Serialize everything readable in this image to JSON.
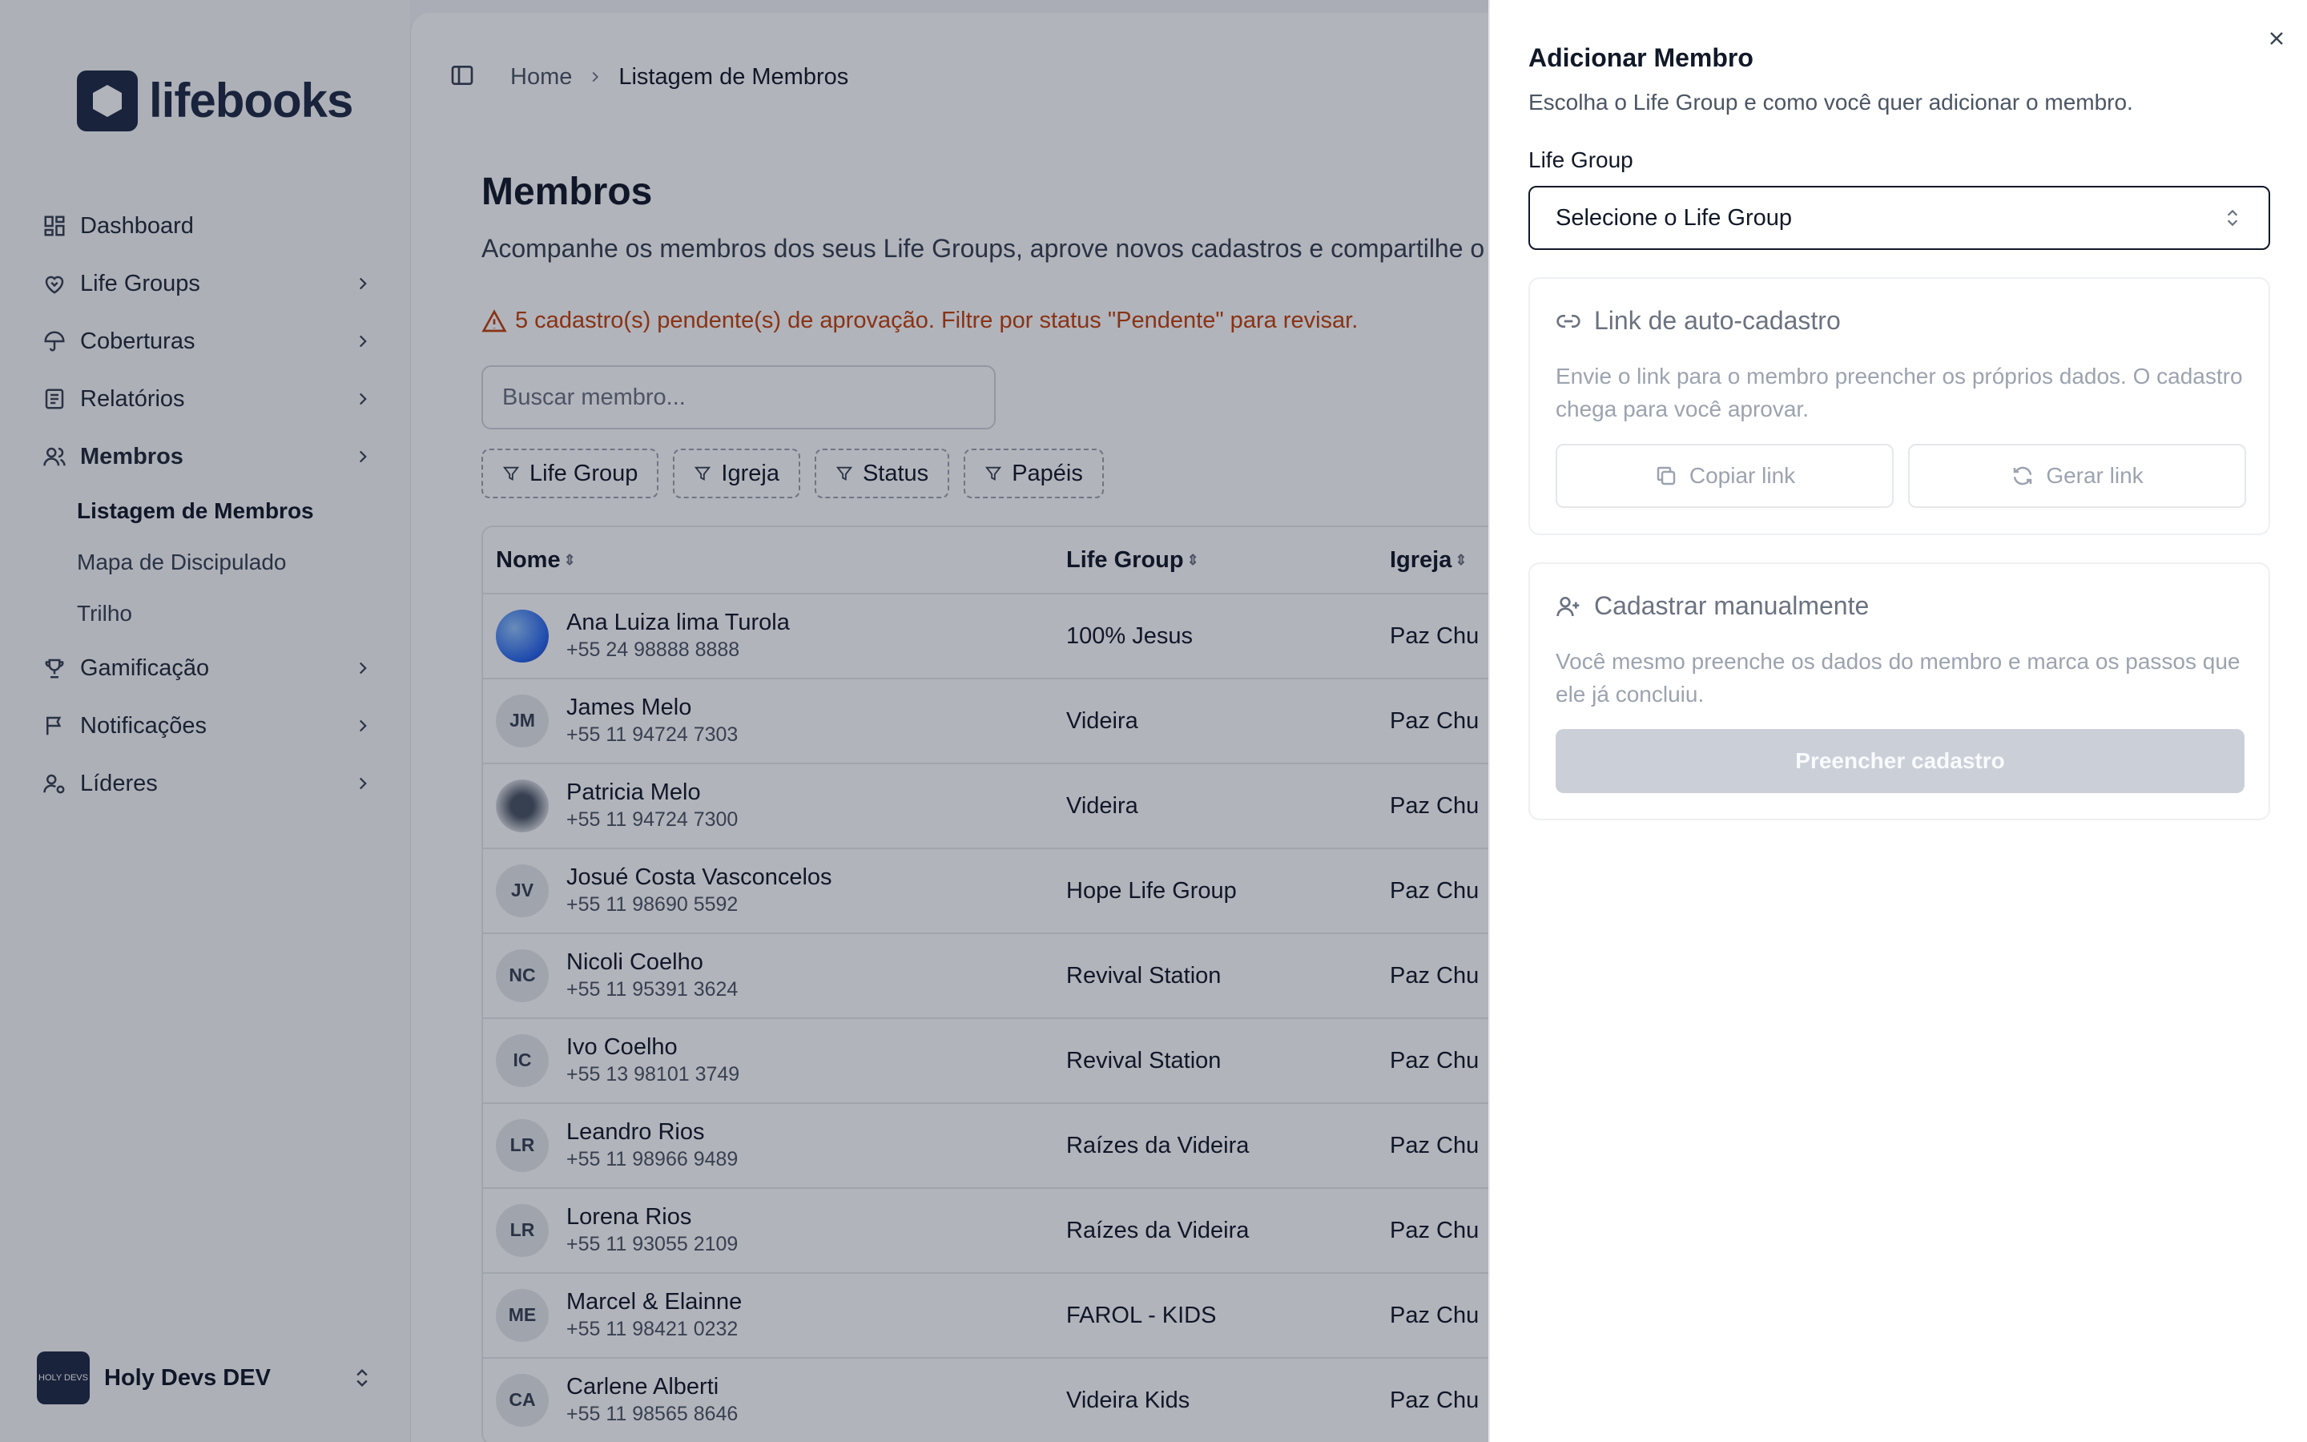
{
  "sidebar": {
    "brand": "lifebooks",
    "items": [
      {
        "label": "Dashboard",
        "icon": "dashboard-icon"
      },
      {
        "label": "Life Groups",
        "icon": "heart-handshake-icon"
      },
      {
        "label": "Coberturas",
        "icon": "umbrella-icon"
      },
      {
        "label": "Relatórios",
        "icon": "report-icon"
      },
      {
        "label": "Membros",
        "icon": "users-icon"
      },
      {
        "label": "Gamificação",
        "icon": "trophy-icon"
      },
      {
        "label": "Notificações",
        "icon": "flag-icon"
      },
      {
        "label": "Líderes",
        "icon": "user-cog-icon"
      }
    ],
    "sub_items": [
      "Listagem de Membros",
      "Mapa de Discipulado",
      "Trilho"
    ],
    "workspace": {
      "name": "Holy Devs DEV",
      "logo_text": "HOLY DEVS"
    }
  },
  "breadcrumb": {
    "home": "Home",
    "current": "Listagem de Membros"
  },
  "main": {
    "title": "Membros",
    "subtitle": "Acompanhe os membros dos seus Life Groups, aprove novos cadastros e compartilhe o",
    "warning": "5 cadastro(s) pendente(s) de aprovação. Filtre por status \"Pendente\" para revisar.",
    "search_placeholder": "Buscar membro...",
    "filters": [
      "Life Group",
      "Igreja",
      "Status",
      "Papéis"
    ]
  },
  "table": {
    "columns": [
      "Nome",
      "Life Group",
      "Igreja"
    ],
    "rows": [
      {
        "name": "Ana Luiza lima Turola",
        "phone": "+55 24 98888 8888",
        "initials": "",
        "group": "100% Jesus",
        "church": "Paz Chu"
      },
      {
        "name": "James Melo",
        "phone": "+55 11 94724 7303",
        "initials": "JM",
        "group": "Videira",
        "church": "Paz Chu"
      },
      {
        "name": "Patricia Melo",
        "phone": "+55 11 94724 7300",
        "initials": "",
        "group": "Videira",
        "church": "Paz Chu"
      },
      {
        "name": "Josué Costa Vasconcelos",
        "phone": "+55 11 98690 5592",
        "initials": "JV",
        "group": "Hope Life Group",
        "church": "Paz Chu"
      },
      {
        "name": "Nicoli Coelho",
        "phone": "+55 11 95391 3624",
        "initials": "NC",
        "group": "Revival Station",
        "church": "Paz Chu"
      },
      {
        "name": "Ivo Coelho",
        "phone": "+55 13 98101 3749",
        "initials": "IC",
        "group": "Revival Station",
        "church": "Paz Chu"
      },
      {
        "name": "Leandro Rios",
        "phone": "+55 11 98966 9489",
        "initials": "LR",
        "group": "Raízes da Videira",
        "church": "Paz Chu"
      },
      {
        "name": "Lorena Rios",
        "phone": "+55 11 93055 2109",
        "initials": "LR",
        "group": "Raízes da Videira",
        "church": "Paz Chu"
      },
      {
        "name": "Marcel & Elainne",
        "phone": "+55 11 98421 0232",
        "initials": "ME",
        "group": "FAROL - KIDS",
        "church": "Paz Chu"
      },
      {
        "name": "Carlene Alberti",
        "phone": "+55 11 98565 8646",
        "initials": "CA",
        "group": "Videira Kids",
        "church": "Paz Chu"
      }
    ]
  },
  "drawer": {
    "title": "Adicionar Membro",
    "subtitle": "Escolha o Life Group e como você quer adicionar o membro.",
    "field_label": "Life Group",
    "select_placeholder": "Selecione o Life Group",
    "link_card": {
      "title": "Link de auto-cadastro",
      "description": "Envie o link para o membro preencher os próprios dados. O cadastro chega para você aprovar.",
      "copy_label": "Copiar link",
      "generate_label": "Gerar link"
    },
    "manual_card": {
      "title": "Cadastrar manualmente",
      "description": "Você mesmo preenche os dados do membro e marca os passos que ele já concluiu.",
      "button_label": "Preencher cadastro"
    }
  }
}
